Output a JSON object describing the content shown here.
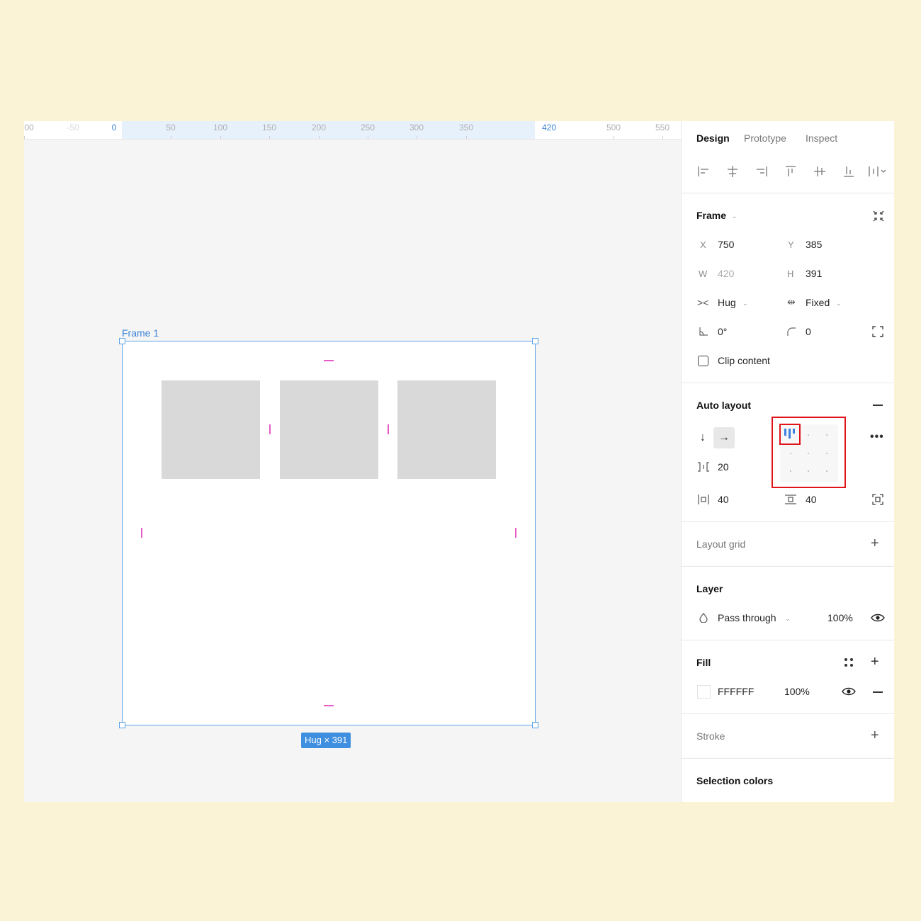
{
  "ruler": {
    "ticks": [
      "00",
      "-50",
      "0",
      "50",
      "100",
      "150",
      "200",
      "250",
      "300",
      "350",
      "420",
      "500",
      "550"
    ]
  },
  "canvas": {
    "frame_label": "Frame 1",
    "size_badge": "Hug × 391",
    "colors": {
      "selection": "#5aa2e6",
      "padding_guide": "#e85bc7",
      "child_fill": "#d9d9d9"
    }
  },
  "panel": {
    "tabs": [
      "Design",
      "Prototype",
      "Inspect"
    ],
    "align_icons": [
      "align-left-icon",
      "align-horizontal-center-icon",
      "align-right-icon",
      "align-top-icon",
      "align-vertical-center-icon",
      "align-bottom-icon",
      "distribute-icon"
    ],
    "frame": {
      "title": "Frame",
      "x_label": "X",
      "x_value": "750",
      "y_label": "Y",
      "y_value": "385",
      "w_label": "W",
      "w_value": "420",
      "h_label": "H",
      "h_value": "391",
      "width_mode": "Hug",
      "height_mode": "Fixed",
      "rotation": "0°",
      "radius": "0",
      "clip_content": "Clip content"
    },
    "auto_layout": {
      "title": "Auto layout",
      "spacing": "20",
      "padding_horizontal": "40",
      "padding_vertical": "40",
      "alignment": "top-left",
      "highlight_color": "#e0131b"
    },
    "layout_grid": {
      "title": "Layout grid"
    },
    "layer": {
      "title": "Layer",
      "blend": "Pass through",
      "opacity": "100%"
    },
    "fill": {
      "title": "Fill",
      "color": "FFFFFF",
      "opacity": "100%"
    },
    "stroke": {
      "title": "Stroke"
    },
    "selection_colors": {
      "title": "Selection colors"
    }
  }
}
